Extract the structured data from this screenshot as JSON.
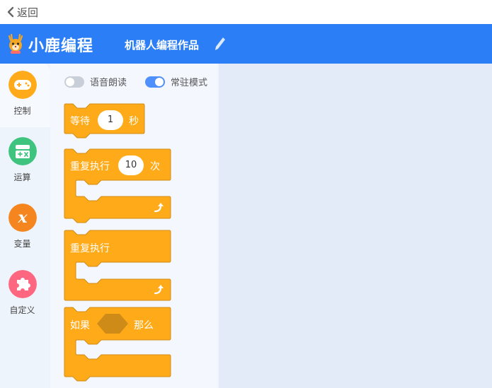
{
  "topbar": {
    "back_label": "返回"
  },
  "header": {
    "app_name": "小鹿编程",
    "project_title": "机器人编程作品"
  },
  "categories": [
    {
      "label": "控制",
      "color": "#ffab19"
    },
    {
      "label": "运算",
      "color": "#3fc480"
    },
    {
      "label": "变量",
      "color": "#f5861f"
    },
    {
      "label": "自定义",
      "color": "#ff6680"
    }
  ],
  "toggles": {
    "voice": {
      "label": "语音朗读",
      "on": false
    },
    "resident": {
      "label": "常驻模式",
      "on": true
    }
  },
  "blocks": {
    "wait": {
      "label": "等待",
      "value": "1",
      "unit": "秒"
    },
    "repeat_n": {
      "label": "重复执行",
      "value": "10",
      "unit": "次"
    },
    "forever": {
      "label": "重复执行"
    },
    "if_then": {
      "label_if": "如果",
      "label_then": "那么"
    }
  },
  "colors": {
    "block": "#ffab19",
    "block_border": "#cf8b17",
    "header": "#2b7ef6",
    "hexagon": "#cf8b17"
  }
}
